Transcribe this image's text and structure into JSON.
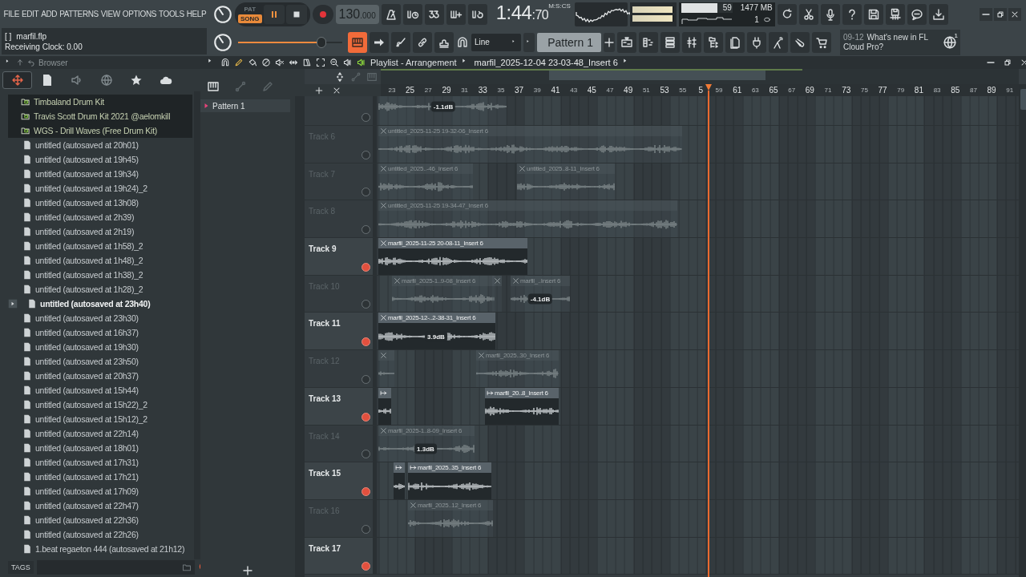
{
  "menu": [
    "FILE",
    "EDIT",
    "ADD",
    "PATTERNS",
    "VIEW",
    "OPTIONS",
    "TOOLS",
    "HELP"
  ],
  "project": {
    "flag": "[   ]",
    "file_name": "marfil.flp",
    "status": "Receiving Clock: 0.00"
  },
  "transport": {
    "modes": [
      {
        "label": "PAT",
        "selected": false
      },
      {
        "label": "SONG",
        "selected": true
      }
    ],
    "playing": true,
    "tempo": "130",
    "tempo_decimals": ".000"
  },
  "time": {
    "value": "1:44",
    "fraction": ":70",
    "unit": "M:S:CS"
  },
  "meters": [
    {
      "level": 0.97
    },
    {
      "level": 0.97
    }
  ],
  "performance": {
    "cpu_meter": {
      "level": 0.7
    },
    "cpu": "59",
    "memory": "1477 MB",
    "polyphony": "1"
  },
  "master_slider": {
    "level": 0.8
  },
  "snap": "Line",
  "pattern_selector": "Pattern 1",
  "news": {
    "date": "09-12",
    "headline": "What's new in FL Cloud Pro?",
    "badge": "1"
  },
  "browser": {
    "title": "Browser",
    "tabs": [
      {
        "selected": true
      },
      {
        "selected": false
      },
      {
        "selected": false
      },
      {
        "selected": false
      },
      {
        "selected": false
      },
      {
        "selected": false
      }
    ],
    "items": [
      {
        "label": "Timbaland Drum Kit",
        "kind": "folder",
        "selected": false
      },
      {
        "label": "Travis Scott Drum Kit 2021 @aelomkill",
        "kind": "folder",
        "selected": false
      },
      {
        "label": "WGS - Drill Waves (Free Drum Kit)",
        "kind": "folder",
        "selected": false
      },
      {
        "label": "untitled (autosaved at 20h01)",
        "kind": "file",
        "selected": false
      },
      {
        "label": "untitled (autosaved at 19h45)",
        "kind": "file",
        "selected": false
      },
      {
        "label": "untitled (autosaved at 19h34)",
        "kind": "file",
        "selected": false
      },
      {
        "label": "untitled (autosaved at 19h24)_2",
        "kind": "file",
        "selected": false
      },
      {
        "label": "untitled (autosaved at 13h08)",
        "kind": "file",
        "selected": false
      },
      {
        "label": "untitled (autosaved at 2h39)",
        "kind": "file",
        "selected": false
      },
      {
        "label": "untitled (autosaved at 2h19)",
        "kind": "file",
        "selected": false
      },
      {
        "label": "untitled (autosaved at 1h58)_2",
        "kind": "file",
        "selected": false
      },
      {
        "label": "untitled (autosaved at 1h48)_2",
        "kind": "file",
        "selected": false
      },
      {
        "label": "untitled (autosaved at 1h38)_2",
        "kind": "file",
        "selected": false
      },
      {
        "label": "untitled (autosaved at 1h28)_2",
        "kind": "file",
        "selected": false
      },
      {
        "label": "untitled (autosaved at 23h40)",
        "kind": "file",
        "selected": true
      },
      {
        "label": "untitled (autosaved at 23h30)",
        "kind": "file",
        "selected": false
      },
      {
        "label": "untitled (autosaved at 16h37)",
        "kind": "file",
        "selected": false
      },
      {
        "label": "untitled (autosaved at 19h30)",
        "kind": "file",
        "selected": false
      },
      {
        "label": "untitled (autosaved at 23h50)",
        "kind": "file",
        "selected": false
      },
      {
        "label": "untitled (autosaved at 20h37)",
        "kind": "file",
        "selected": false
      },
      {
        "label": "untitled (autosaved at 15h44)",
        "kind": "file",
        "selected": false
      },
      {
        "label": "untitled (autosaved at 15h22)_2",
        "kind": "file",
        "selected": false
      },
      {
        "label": "untitled (autosaved at 15h12)_2",
        "kind": "file",
        "selected": false
      },
      {
        "label": "untitled (autosaved at 22h14)",
        "kind": "file",
        "selected": false
      },
      {
        "label": "untitled (autosaved at 18h01)",
        "kind": "file",
        "selected": false
      },
      {
        "label": "untitled (autosaved at 17h31)",
        "kind": "file",
        "selected": false
      },
      {
        "label": "untitled (autosaved at 17h21)",
        "kind": "file",
        "selected": false
      },
      {
        "label": "untitled (autosaved at 17h09)",
        "kind": "file",
        "selected": false
      },
      {
        "label": "untitled (autosaved at 22h47)",
        "kind": "file",
        "selected": false
      },
      {
        "label": "untitled (autosaved at 22h36)",
        "kind": "file",
        "selected": false
      },
      {
        "label": "untitled (autosaved at 22h26)",
        "kind": "file",
        "selected": false
      },
      {
        "label": "1.beat regaeton 444 (autosaved at 21h12)",
        "kind": "file",
        "selected": false
      }
    ],
    "tags_label": "TAGS"
  },
  "playlist": {
    "title": "Playlist - Arrangement",
    "path": "marfil_2025-12-04 23-03-48_Insert 6",
    "patterns": [
      {
        "label": "Pattern 1",
        "selected": true
      }
    ],
    "ruler": [
      "23",
      "25",
      "27",
      "29",
      "31",
      "33",
      "35",
      "37",
      "39",
      "41",
      "43",
      "45",
      "47",
      "49",
      "51",
      "53",
      "55",
      "5",
      "59",
      "61",
      "63",
      "65",
      "67",
      "69",
      "71",
      "73",
      "75",
      "77",
      "79",
      "81",
      "83",
      "85",
      "87",
      "89",
      "91"
    ],
    "tracks": [
      {
        "enabled": false,
        "clips": [
          {
            "kind": "bare",
            "gain": "-1.1dB"
          }
        ]
      },
      {
        "name": "Track 6",
        "enabled": false,
        "clips": [
          {
            "kind": "cross",
            "title": "untitled_2025-11-25 19-32-06_Insert 6"
          }
        ]
      },
      {
        "name": "Track 7",
        "enabled": false,
        "clips": [
          {
            "kind": "cross",
            "title": "untitled_2025..-46_Insert 6"
          },
          {
            "kind": "cross",
            "title": "untitled_2025..8-11_Insert 6"
          }
        ]
      },
      {
        "name": "Track 8",
        "enabled": false,
        "clips": [
          {
            "kind": "cross",
            "title": "untitled_2025-11-25 19-34-47_Insert 6"
          }
        ]
      },
      {
        "name": "Track 9",
        "enabled": true,
        "clips": [
          {
            "kind": "cross",
            "title": "marfil_2025-11-25 20-08-11_Insert 6"
          }
        ]
      },
      {
        "name": "Track 10",
        "enabled": false,
        "clips": [
          {
            "kind": "cross",
            "title": "marfil_2025-1..9-08_Insert 6"
          },
          {
            "kind": "cross"
          },
          {
            "kind": "cross",
            "title": "marfil_..Insert 6",
            "gain": "-4.1dB"
          }
        ]
      },
      {
        "name": "Track 11",
        "enabled": true,
        "clips": [
          {
            "kind": "cross",
            "title": "marfil_2025-12-..2-38-31_Insert 6",
            "gain": "3.9dB"
          }
        ]
      },
      {
        "name": "Track 12",
        "enabled": false,
        "clips": [
          {
            "kind": "cross"
          },
          {
            "kind": "cross",
            "title": "marfil_2025..30_Insert 6"
          }
        ]
      },
      {
        "name": "Track 13",
        "enabled": true,
        "clips": [
          {
            "kind": "stretch"
          },
          {
            "kind": "stretch",
            "title": "marfil_20..8_Insert 6"
          }
        ]
      },
      {
        "name": "Track 14",
        "enabled": false,
        "clips": [
          {
            "kind": "cross",
            "title": "marfil_2025-1..8-09_Insert 6",
            "gain": "1.3dB"
          }
        ]
      },
      {
        "name": "Track 15",
        "enabled": true,
        "clips": [
          {
            "kind": "stretch"
          },
          {
            "kind": "stretch",
            "title": "marfil_2025..35_Insert 6"
          }
        ]
      },
      {
        "name": "Track 16",
        "enabled": false,
        "clips": [
          {
            "kind": "cross",
            "title": "marfil_2025..12_Insert 6"
          }
        ]
      },
      {
        "name": "Track 17",
        "enabled": true
      }
    ]
  }
}
